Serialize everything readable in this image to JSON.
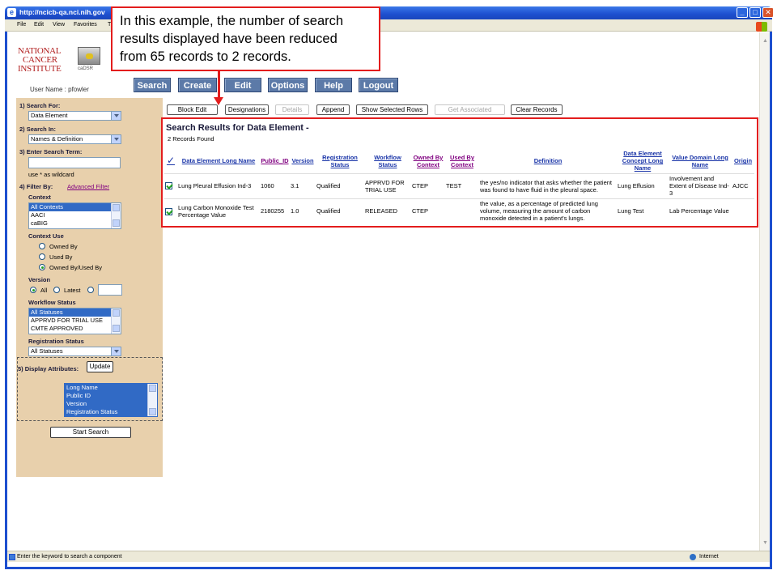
{
  "window": {
    "title_url": "http://ncicb-qa.nci.nih.gov",
    "minimize": "_",
    "maximize": "□",
    "close": "✕"
  },
  "menu": {
    "file": "File",
    "edit": "Edit",
    "view": "View",
    "favorites": "Favorites",
    "tools": "T"
  },
  "callout": {
    "line1": "In this example, the number of search",
    "line2": "results displayed have been reduced",
    "line3": "from 65 records to 2 records."
  },
  "header": {
    "logo_line1": "NATIONAL",
    "logo_line2": "CANCER",
    "logo_line3": "INSTITUTE",
    "cadsr_label": "caDSR",
    "username": "User Name : pfowler"
  },
  "nav": [
    "Search",
    "Create",
    "Edit",
    "Options",
    "Help",
    "Logout"
  ],
  "left": {
    "search_for_label": "1)  Search For:",
    "search_for_value": "Data Element",
    "search_in_label": "2)  Search In:",
    "search_in_value": "Names & Definition",
    "term_label": "3)  Enter Search Term:",
    "term_value": "",
    "wildcard_hint": "use * as wildcard",
    "filter_label": "4)  Filter By:",
    "advanced_filter": "Advanced Filter",
    "context_label": "Context",
    "context_options": [
      "All Contexts",
      "AACI",
      "caBIG"
    ],
    "context_use_label": "Context Use",
    "context_use_options": [
      "Owned By",
      "Used By",
      "Owned By/Used By"
    ],
    "context_use_selected": "Owned By/Used By",
    "version_label": "Version",
    "version_all": "All",
    "version_latest": "Latest",
    "version_selected": "All",
    "workflow_label": "Workflow Status",
    "workflow_options": [
      "All Statuses",
      "APPRVD FOR TRIAL USE",
      "CMTE APPROVED"
    ],
    "registration_label": "Registration Status",
    "registration_value": "All Statuses",
    "display_attr_label": "5)  Display Attributes:",
    "update_button": "Update",
    "display_attr_options": [
      "Long Name",
      "Public ID",
      "Version",
      "Registration Status"
    ],
    "start_search_button": "Start Search"
  },
  "toolbar": {
    "block_edit": "Block Edit",
    "designations": "Designations",
    "details": "Details",
    "append": "Append",
    "show_selected": "Show Selected Rows",
    "get_associated": "Get Associated",
    "clear_records": "Clear Records"
  },
  "results": {
    "title": "Search Results for Data Element -",
    "count": "2 Records Found",
    "columns": [
      "Data Element Long Name",
      "Public_ID",
      "Version",
      "Registration Status",
      "Workflow Status",
      "Owned By Context",
      "Used By Context",
      "Definition",
      "Data Element Concept Long Name",
      "Value Domain Long Name",
      "Origin"
    ],
    "rows": [
      {
        "name": "Lung Pleural Effusion Ind-3",
        "public_id": "1060",
        "version": "3.1",
        "registration": "Qualified",
        "workflow": "APPRVD FOR TRIAL USE",
        "owned_by": "CTEP",
        "used_by": "TEST",
        "definition": "the yes/no indicator that asks whether the patient was found to have fluid in the pleural space.",
        "dec_name": "Lung Effusion",
        "vd_name": "Involvement and Extent of Disease Ind-3",
        "origin": "AJCC"
      },
      {
        "name": "Lung Carbon Monoxide Test Percentage Value",
        "public_id": "2180255",
        "version": "1.0",
        "registration": "Qualified",
        "workflow": "RELEASED",
        "owned_by": "CTEP",
        "used_by": "",
        "definition": "the value, as a percentage of predicted lung volume, measuring the amount of carbon monoxide detected in a patient's lungs.",
        "dec_name": "Lung Test",
        "vd_name": "Lab Percentage Value",
        "origin": ""
      }
    ]
  },
  "status": {
    "message": "Enter the keyword to search a component",
    "zone": "Internet"
  },
  "colors": {
    "highlight": "#e31d1d",
    "nav_button": "#5c7aa8",
    "panel": "#e8d0ac",
    "title_bar": "#1d4fcf"
  }
}
